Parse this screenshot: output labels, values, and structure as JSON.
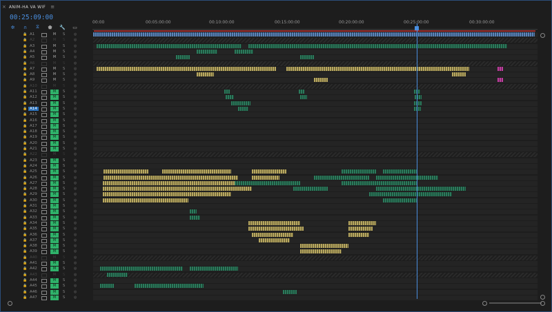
{
  "panel": {
    "close_glyph": "×",
    "title": "ANIM-HA VA WIF",
    "menu_glyph": "≡"
  },
  "timecode": "00:25:09:00",
  "tools": [
    {
      "name": "snap-icon",
      "glyph": "✲"
    },
    {
      "name": "linked-selection-icon",
      "glyph": "∩"
    },
    {
      "name": "add-marker-icon",
      "glyph": "⧖"
    },
    {
      "name": "marker-icon",
      "glyph": "⬟"
    },
    {
      "name": "wrench-icon",
      "glyph": "🔧"
    },
    {
      "name": "captions-icon",
      "glyph": "▭"
    }
  ],
  "ruler": {
    "labels": [
      "00:00",
      "00:05:00:00",
      "00:10:00:00",
      "00:15:00:00",
      "00:20:00:00",
      "00:25:00:00",
      "00:30:00:00"
    ]
  },
  "colors": {
    "accent": "#4a8fe0",
    "mute_on": "#2fb26a",
    "selected": "#2a6fb8"
  },
  "tracks": [
    {
      "name": "A1",
      "muted": false
    },
    {
      "name": "A2",
      "muted": false,
      "disabled": true
    },
    {
      "name": "A3",
      "muted": false
    },
    {
      "name": "A4",
      "muted": false
    },
    {
      "name": "A5",
      "muted": false
    },
    {
      "name": "A6",
      "muted": false,
      "disabled": true
    },
    {
      "name": "A7",
      "muted": false
    },
    {
      "name": "A8",
      "muted": false
    },
    {
      "name": "A9",
      "muted": false
    },
    {
      "name": "A10",
      "muted": false,
      "disabled": true
    },
    {
      "name": "A11",
      "muted": true
    },
    {
      "name": "A12",
      "muted": true
    },
    {
      "name": "A13",
      "muted": true
    },
    {
      "name": "A14",
      "muted": true,
      "selected": true
    },
    {
      "name": "A15",
      "muted": true
    },
    {
      "name": "A16",
      "muted": true
    },
    {
      "name": "A17",
      "muted": true
    },
    {
      "name": "A18",
      "muted": true
    },
    {
      "name": "A19",
      "muted": true
    },
    {
      "name": "A20",
      "muted": true
    },
    {
      "name": "A21",
      "muted": true
    },
    {
      "name": "A22",
      "muted": false,
      "disabled": true
    },
    {
      "name": "A23",
      "muted": true
    },
    {
      "name": "A24",
      "muted": true
    },
    {
      "name": "A25",
      "muted": true
    },
    {
      "name": "A26",
      "muted": true
    },
    {
      "name": "A27",
      "muted": true
    },
    {
      "name": "A28",
      "muted": true
    },
    {
      "name": "A29",
      "muted": true
    },
    {
      "name": "A30",
      "muted": true
    },
    {
      "name": "A31",
      "muted": true
    },
    {
      "name": "A32",
      "muted": true
    },
    {
      "name": "A33",
      "muted": true
    },
    {
      "name": "A34",
      "muted": true
    },
    {
      "name": "A35",
      "muted": true
    },
    {
      "name": "A36",
      "muted": true
    },
    {
      "name": "A37",
      "muted": true
    },
    {
      "name": "A38",
      "muted": true
    },
    {
      "name": "A39",
      "muted": true
    },
    {
      "name": "A40",
      "muted": false,
      "disabled": true
    },
    {
      "name": "A41",
      "muted": true
    },
    {
      "name": "A42",
      "muted": true
    },
    {
      "name": "A43",
      "muted": false,
      "disabled": true
    },
    {
      "name": "A44",
      "muted": true
    },
    {
      "name": "A45",
      "muted": true
    },
    {
      "name": "A46",
      "muted": true
    },
    {
      "name": "A47",
      "muted": true
    }
  ],
  "labels": {
    "mute": "M",
    "solo": "S",
    "lock": "🔒",
    "mic": "◎"
  }
}
